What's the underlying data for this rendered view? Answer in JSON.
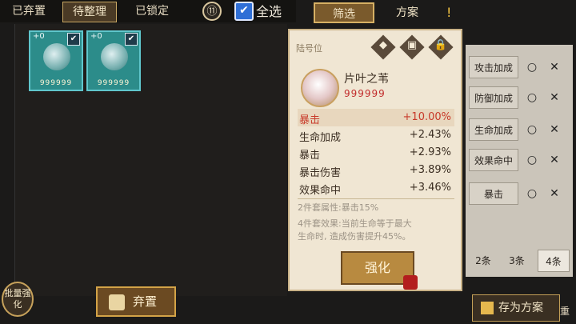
{
  "tabs": {
    "abandoned": "已弃置",
    "pending": "待整理",
    "locked": "已锁定",
    "circle_icon_label": "⑪",
    "select_all": "全选",
    "select_all_check": "✔"
  },
  "cards": [
    {
      "level": "+0",
      "stars": "999999",
      "check": "✔"
    },
    {
      "level": "+0",
      "stars": "999999",
      "check": "✔"
    }
  ],
  "bottom": {
    "batch_enhance": "批量强化",
    "abandon": "弃置"
  },
  "detail": {
    "position": "陆号位",
    "slot_icons": [
      "◆",
      "▣",
      "🔒"
    ],
    "soul_name": "片叶之苇",
    "soul_stars": "999999",
    "main_stat": {
      "name": "暴击",
      "value": "+10.00%"
    },
    "sub_stats": [
      {
        "name": "生命加成",
        "value": "+2.43%"
      },
      {
        "name": "暴击",
        "value": "+2.93%"
      },
      {
        "name": "暴击伤害",
        "value": "+3.89%"
      },
      {
        "name": "效果命中",
        "value": "+3.46%"
      }
    ],
    "set2": "2件套属性:暴击15%",
    "set4_line1": "4件套效果:当前生命等于最大",
    "set4_line2": "生命时, 造成伤害提升45%。",
    "enhance": "强化"
  },
  "filter": {
    "tab_filter": "筛选",
    "tab_scheme": "方案",
    "warn_icon": "!",
    "rows": [
      {
        "label": "攻击加成",
        "o": "○",
        "x": "✕"
      },
      {
        "label": "防御加成",
        "o": "○",
        "x": "✕"
      },
      {
        "label": "生命加成",
        "o": "○",
        "x": "✕"
      },
      {
        "label": "效果命中",
        "o": "○",
        "x": "✕"
      },
      {
        "label": "暴击",
        "o": "○",
        "x": "✕"
      }
    ],
    "counts": [
      "2条",
      "3条",
      "4条"
    ],
    "save_scheme": "存为方案",
    "reset_partial": "重"
  }
}
